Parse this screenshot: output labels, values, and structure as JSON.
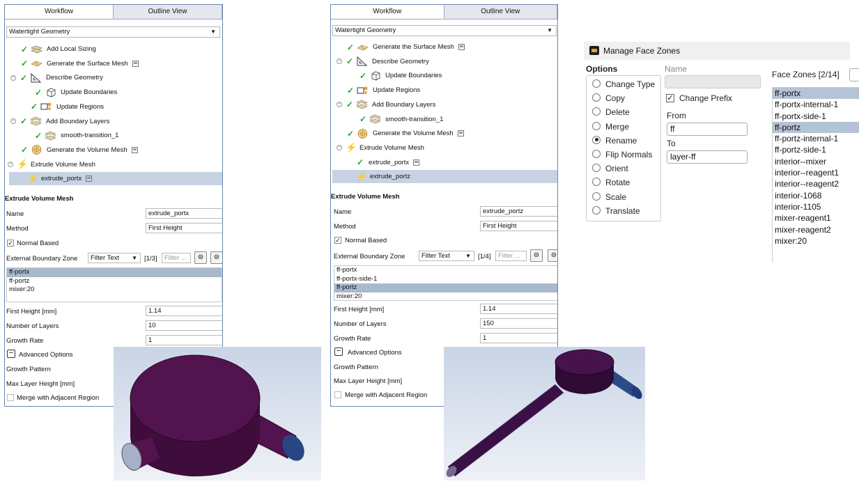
{
  "left_panel": {
    "tabs": [
      "Workflow",
      "Outline View"
    ],
    "mode_select": "Watertight Geometry",
    "tree": [
      {
        "label": "Add Local Sizing",
        "icon": "planes-icon",
        "check": true,
        "saved": false
      },
      {
        "label": "Generate the Surface Mesh",
        "icon": "surface-mesh-icon",
        "check": true,
        "saved": true
      },
      {
        "label": "Describe Geometry",
        "icon": "triangle-ruler-icon",
        "check": true,
        "saved": false
      },
      {
        "label": "Update Boundaries",
        "icon": "cube-icon",
        "check": true,
        "saved": false
      },
      {
        "label": "Update Regions",
        "icon": "regions-icon",
        "check": true,
        "saved": false
      },
      {
        "label": "Add Boundary Layers",
        "icon": "layers-icon",
        "check": true,
        "saved": false
      },
      {
        "label": "smooth-transition_1",
        "icon": "layers-icon",
        "check": true,
        "saved": false
      },
      {
        "label": "Generate the Volume Mesh",
        "icon": "volume-mesh-icon",
        "check": true,
        "saved": true
      },
      {
        "label": "Extrude Volume Mesh",
        "icon": "lightning-icon",
        "check": false,
        "saved": false
      },
      {
        "label": "extrude_portx",
        "icon": "lightning-icon",
        "check": false,
        "saved": true
      }
    ],
    "section_title": "Extrude Volume Mesh",
    "name_label": "Name",
    "name_value": "extrude_portx",
    "method_label": "Method",
    "method_value": "First Height",
    "normal_based": "Normal Based",
    "ext_zone_label": "External Boundary Zone",
    "filter_select": "Filter Text",
    "count": "[1/3]",
    "filter_placeholder": "Filter ...",
    "zones": [
      "ff-portx",
      "ff-portz",
      "mixer:20"
    ],
    "first_height_label": "First Height [mm]",
    "first_height_value": "1.14",
    "num_layers_label": "Number of Layers",
    "num_layers_value": "10",
    "growth_rate_label": "Growth Rate",
    "growth_rate_value": "1",
    "advanced": "Advanced Options",
    "growth_pattern": "Growth Pattern",
    "max_layer": "Max Layer Height [mm]",
    "merge": "Merge with Adjacent Region"
  },
  "mid_panel": {
    "tabs": [
      "Workflow",
      "Outline View"
    ],
    "mode_select": "Watertight Geometry",
    "tree": [
      {
        "label": "Generate the Surface Mesh",
        "icon": "surface-mesh-icon",
        "check": true,
        "saved": true
      },
      {
        "label": "Describe Geometry",
        "icon": "triangle-ruler-icon",
        "check": true,
        "saved": false
      },
      {
        "label": "Update Boundaries",
        "icon": "cube-icon",
        "check": true,
        "saved": false
      },
      {
        "label": "Update Regions",
        "icon": "regions-icon",
        "check": true,
        "saved": false
      },
      {
        "label": "Add Boundary Layers",
        "icon": "layers-icon",
        "check": true,
        "saved": false
      },
      {
        "label": "smooth-transition_1",
        "icon": "layers-icon",
        "check": true,
        "saved": false
      },
      {
        "label": "Generate the Volume Mesh",
        "icon": "volume-mesh-icon",
        "check": true,
        "saved": true
      },
      {
        "label": "Extrude Volume Mesh",
        "icon": "lightning-icon",
        "check": false,
        "saved": false
      },
      {
        "label": "extrude_portx",
        "icon": "none",
        "check": true,
        "saved": true
      },
      {
        "label": "extrude_portz",
        "icon": "lightning-icon",
        "check": false,
        "saved": false
      }
    ],
    "section_title": "Extrude Volume Mesh",
    "name_label": "Name",
    "name_value": "extrude_portz",
    "method_label": "Method",
    "method_value": "First Height",
    "normal_based": "Normal Based",
    "ext_zone_label": "External Boundary Zone",
    "filter_select": "Filter Text",
    "count": "[1/4]",
    "filter_placeholder": "Filter ...",
    "zones": [
      "ff-portx",
      "ff-portx-side-1",
      "ff-portz",
      "mixer:20"
    ],
    "first_height_label": "First Height [mm]",
    "first_height_value": "1.14",
    "num_layers_label": "Number of Layers",
    "num_layers_value": "150",
    "growth_rate_label": "Growth Rate",
    "growth_rate_value": "1",
    "advanced": "Advanced Options",
    "growth_pattern": "Growth Pattern",
    "max_layer": "Max Layer Height [mm]",
    "merge": "Merge with Adjacent Region"
  },
  "dialog": {
    "title": "Manage Face Zones",
    "options_label": "Options",
    "options": [
      "Change Type",
      "Copy",
      "Delete",
      "Merge",
      "Rename",
      "Flip Normals",
      "Orient",
      "Rotate",
      "Scale",
      "Translate"
    ],
    "selected_option": "Rename",
    "name_label": "Name",
    "change_prefix": "Change Prefix",
    "from_label": "From",
    "from_value": "ff",
    "to_label": "To",
    "to_value": "layer-ff",
    "face_zones_label": "Face Zones",
    "face_zones_count": "[2/14]",
    "zones": [
      "ff-portx",
      "ff-portx-internal-1",
      "ff-portx-side-1",
      "ff-portz",
      "ff-portz-internal-1",
      "ff-portz-side-1",
      "interior--mixer",
      "interior--reagent1",
      "interior--reagent2",
      "interior-1068",
      "interior-1105",
      "mixer-reagent1",
      "mixer-reagent2",
      "mixer:20"
    ],
    "selected_zones": [
      "ff-portx",
      "ff-portz"
    ]
  },
  "colors": {
    "mesh_body": "#5a1656",
    "mesh_port": "#2c4a88",
    "panel_border": "#6a86ad",
    "selection": "#c7d3e2"
  }
}
